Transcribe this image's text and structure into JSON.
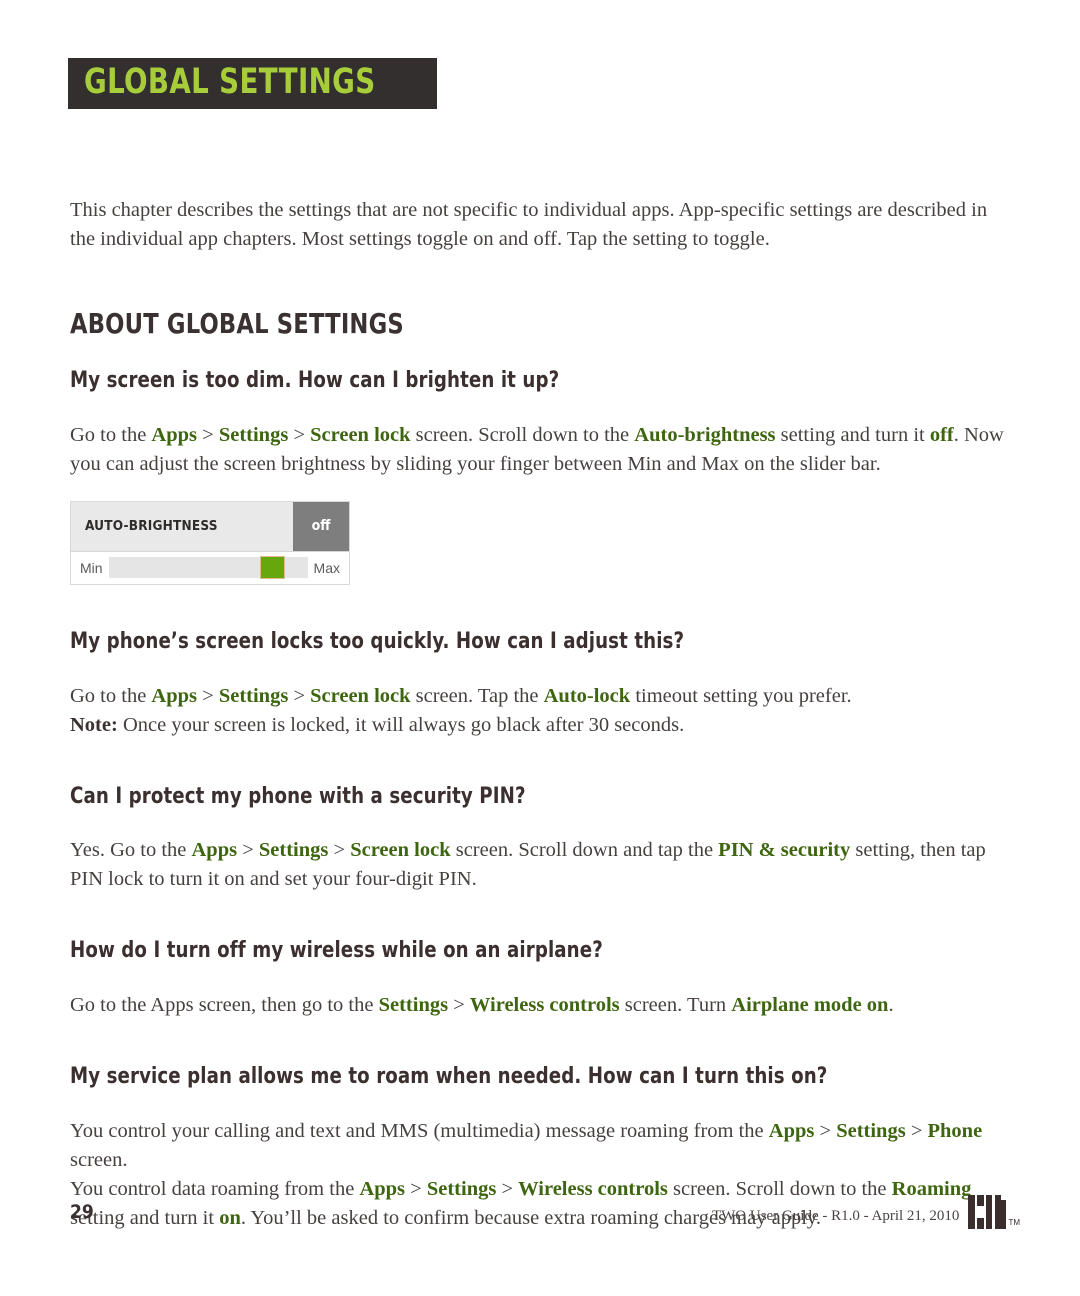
{
  "chapter": {
    "banner_title": "GLOBAL SETTINGS"
  },
  "intro": {
    "paragraph": "This chapter describes the settings that are not specific to individual apps. App-specific settings are described in the individual app chapters. Most settings toggle on and off. Tap the setting to toggle."
  },
  "section": {
    "title": "ABOUT GLOBAL SETTINGS"
  },
  "faqs": [
    {
      "title": "My screen is too dim. How can I brighten it up?",
      "body": {
        "t1": "Go to the ",
        "k1": "Apps",
        "s1": " > ",
        "k2": "Settings",
        "s2": " > ",
        "k3": "Screen lock",
        "t2": " screen. Scroll down to the ",
        "k4": "Auto-brightness",
        "t3": " setting and turn it ",
        "k5": "off",
        "t4": ". Now you can adjust the screen brightness by sliding your finger between Min and Max on the slider bar."
      }
    },
    {
      "title": "My phone’s screen locks too quickly. How can I adjust this?",
      "body": {
        "t1": "Go to the ",
        "k1": "Apps",
        "s1": " > ",
        "k2": "Settings",
        "s2": " > ",
        "k3": "Screen lock",
        "t2": " screen. Tap the ",
        "k4": "Auto-lock",
        "t3": " timeout setting you prefer."
      },
      "note": {
        "label": "Note:",
        "text": " Once your screen is locked, it will always go black after 30 seconds."
      }
    },
    {
      "title": "Can I protect my phone with a security PIN?",
      "body": {
        "t1": "Yes. Go to the ",
        "k1": "Apps",
        "s1": " > ",
        "k2": "Settings",
        "s2": " > ",
        "k3": "Screen lock",
        "t2": " screen. Scroll down and tap the ",
        "k4": "PIN & security",
        "t3": " setting, then tap PIN lock to turn it on and set your four-digit PIN."
      }
    },
    {
      "title": "How do I turn off my wireless while on an airplane?",
      "body": {
        "t1": "Go to the Apps screen, then go to the ",
        "k1": "Settings",
        "s1": " > ",
        "k2": "Wireless controls",
        "t2": " screen. Turn ",
        "k3": "Airplane mode on",
        "t3": "."
      }
    },
    {
      "title": "My service plan allows me to roam when needed. How can I turn this on?",
      "body": {
        "t1": "You control your calling and text and MMS (multimedia) message roaming from the ",
        "k1": "Apps",
        "s1": " > ",
        "k2": "Settings",
        "s2": " > ",
        "k3": "Phone",
        "t2": " screen."
      },
      "body2": {
        "t1": "You control data roaming from the ",
        "k1": "Apps",
        "s1": " > ",
        "k2": "Settings",
        "s2": " > ",
        "k3": "Wireless controls",
        "t2": " screen. Scroll down to the ",
        "k4": "Roaming",
        "t3": " setting and turn it ",
        "k5": "on",
        "t4": ". You’ll be asked to confirm because extra roaming charges may apply."
      }
    }
  ],
  "widget": {
    "label": "AUTO-BRIGHTNESS",
    "state": "off",
    "slider_min": "Min",
    "slider_max": "Max",
    "thumb_position_percent": "76"
  },
  "footer": {
    "page_number": "29",
    "doc_info": "TWO User Guide - R1.0 - April 21, 2010",
    "logo_text": "KIN",
    "trademark": "TM"
  },
  "colors": {
    "banner_bg": "#332F2E",
    "banner_text": "#A7CE3A",
    "heading": "#3A3132",
    "body_text": "#46403F",
    "keyword_green": "#3E650F",
    "widget_label_bg": "#E9E9E9",
    "widget_state_bg": "#7E7E7E",
    "slider_thumb": "#66A70D"
  }
}
